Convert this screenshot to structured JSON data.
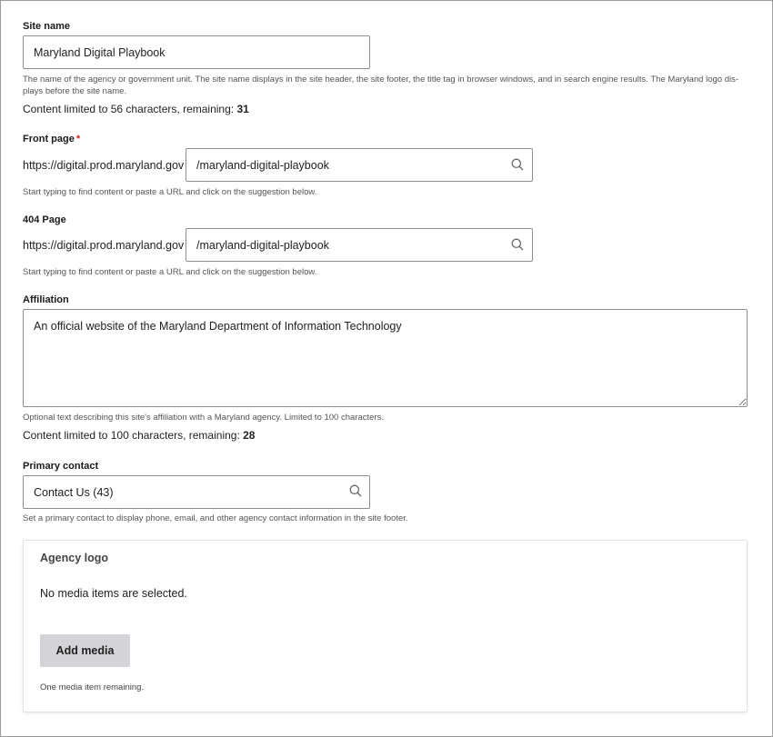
{
  "site_name": {
    "label": "Site name",
    "value": "Maryland Digital Playbook",
    "description_line1": "The name of the agency or government unit. The site name displays in the site header, the site footer, the title tag in browser windows, and in search engine results. The Maryland logo dis-",
    "description_line2": "plays before the site name.",
    "counter_text": "Content limited to 56 characters, remaining: ",
    "counter_remaining": "31"
  },
  "front_page": {
    "label": "Front page",
    "required_mark": "*",
    "prefix": "https://digital.prod.maryland.gov",
    "value": "/maryland-digital-playbook",
    "description": "Start typing to find content or paste a URL and click on the suggestion below."
  },
  "page_404": {
    "label": "404 Page",
    "prefix": "https://digital.prod.maryland.gov",
    "value": "/maryland-digital-playbook",
    "description": "Start typing to find content or paste a URL and click on the suggestion below."
  },
  "affiliation": {
    "label": "Affiliation",
    "value": "An official website of the Maryland Department of Information Technology",
    "description": "Optional text describing this site's affiliation with a Maryland agency. Limited to 100 characters.",
    "counter_text": "Content limited to 100 characters, remaining: ",
    "counter_remaining": "28"
  },
  "primary_contact": {
    "label": "Primary contact",
    "value": "Contact Us (43)",
    "description": "Set a primary contact to display phone, email, and other agency contact information in the site footer."
  },
  "agency_logo": {
    "title": "Agency logo",
    "empty_text": "No media items are selected.",
    "add_button": "Add media",
    "remaining_text": "One media item remaining."
  },
  "icons": {
    "search": "search-icon",
    "resize": "resize-handle-icon"
  },
  "colors": {
    "required": "#d72222",
    "button_bg": "#d4d4d8",
    "border": "#8e8e8e"
  }
}
